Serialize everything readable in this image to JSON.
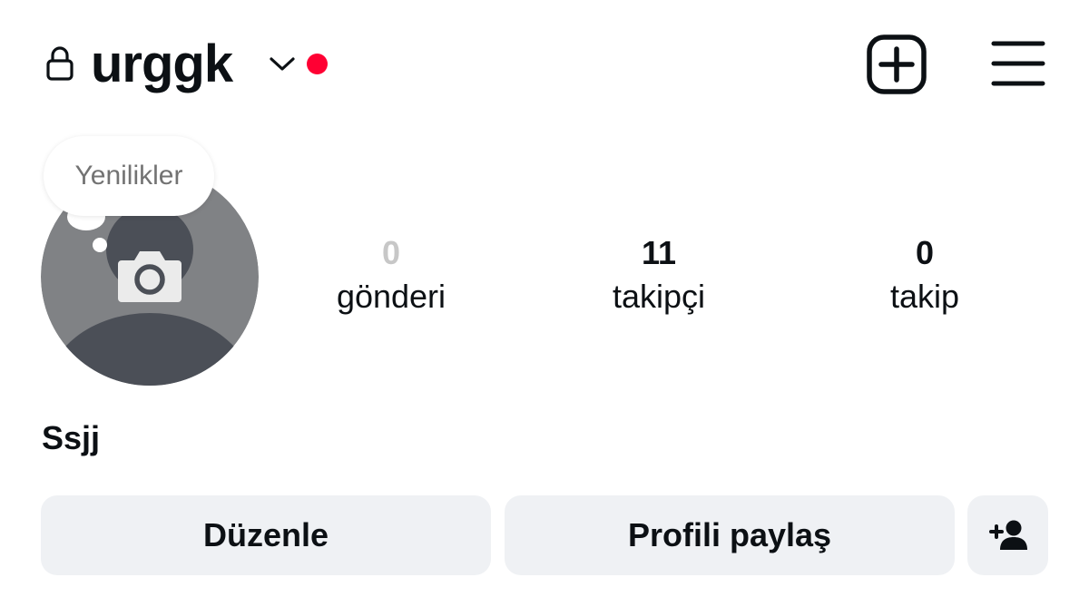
{
  "header": {
    "username": "urggk",
    "icons": {
      "lock": "lock-icon",
      "switch_account": "chevron-down-icon",
      "notification": "red-dot",
      "new_post": "plus-square-icon",
      "menu": "hamburger-menu-icon"
    },
    "notification_color": "#ff0033"
  },
  "profile": {
    "avatar_icon": "camera-icon",
    "notes_bubble": "Yenilikler",
    "display_name": "Ssjj"
  },
  "stats": {
    "posts": {
      "count": "0",
      "label": "gönderi"
    },
    "followers": {
      "count": "11",
      "label": "takipçi"
    },
    "following": {
      "count": "0",
      "label": "takip"
    }
  },
  "actions": {
    "edit_label": "Düzenle",
    "share_label": "Profili paylaş",
    "discover_people_icon": "add-person-icon"
  },
  "colors": {
    "button_bg": "#eff1f4",
    "text": "#0c1014",
    "muted_text": "#c7c7c7",
    "avatar_bg": "#808285",
    "avatar_dark": "#4b4f57"
  }
}
